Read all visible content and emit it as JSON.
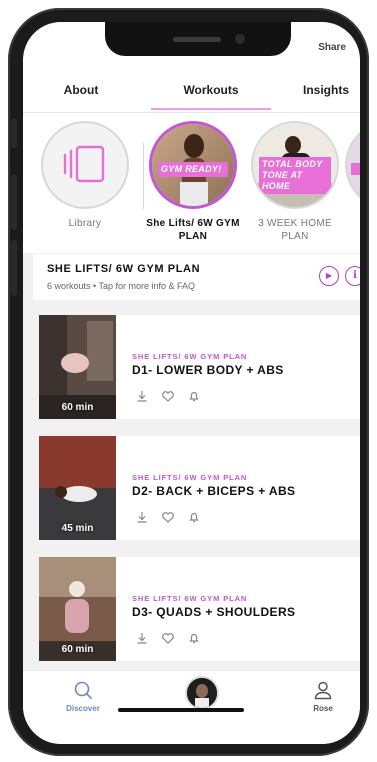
{
  "header": {
    "share_label": "Share"
  },
  "tabs": [
    {
      "label": "About"
    },
    {
      "label": "Workouts"
    },
    {
      "label": "Insights"
    }
  ],
  "plans": [
    {
      "label": "Library",
      "icon": "library-icon"
    },
    {
      "label": "She Lifts/ 6W GYM PLAN",
      "tag": "GYM READY!"
    },
    {
      "label": "3 WEEK HOME PLAN",
      "tag": "TOTAL BODY TONE AT HOME"
    }
  ],
  "plan_card": {
    "title": "SHE LIFTS/ 6W GYM PLAN",
    "subtitle": "6 workouts  •  Tap for more info & FAQ",
    "play_glyph": "▶",
    "info_glyph": "i"
  },
  "workouts": [
    {
      "plan": "SHE LIFTS/ 6W GYM PLAN",
      "title": "D1- LOWER BODY + ABS",
      "duration": "60 min"
    },
    {
      "plan": "SHE LIFTS/ 6W GYM PLAN",
      "title": "D2- BACK + BICEPS + ABS",
      "duration": "45 min"
    },
    {
      "plan": "SHE LIFTS/ 6W GYM PLAN",
      "title": "D3- QUADS + SHOULDERS",
      "duration": "60 min"
    }
  ],
  "bottom_nav": {
    "discover_label": "Discover",
    "profile_label": "Rose"
  },
  "colors": {
    "accent": "#c455d8",
    "tag_pink": "#e86fd6",
    "discover_blue": "#6b87c9"
  }
}
